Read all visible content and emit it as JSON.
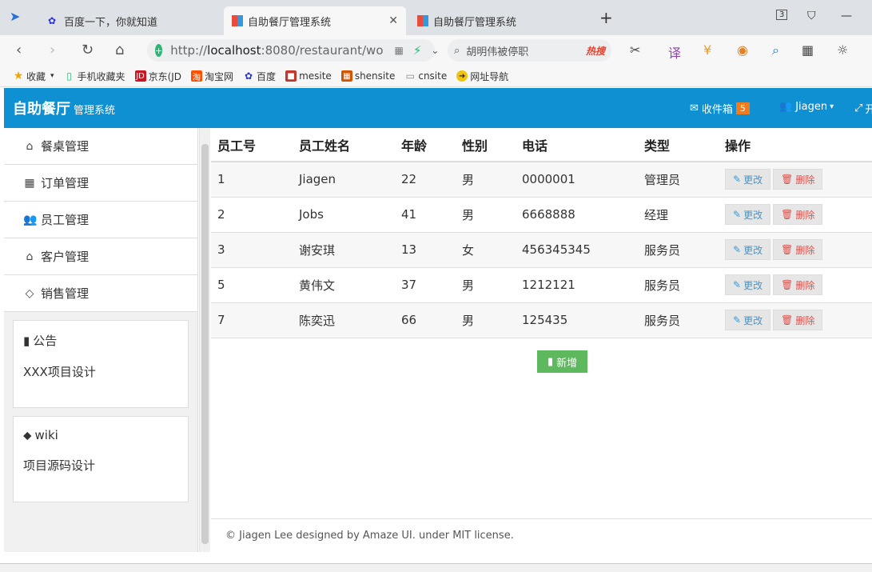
{
  "browser": {
    "tabs": [
      {
        "title": "百度一下，你就知道",
        "active": false
      },
      {
        "title": "自助餐厅管理系统",
        "active": true
      },
      {
        "title": "自助餐厅管理系统",
        "active": false
      }
    ],
    "new_tab": "+",
    "tab_count": "3",
    "url_prefix": "http://",
    "url_host": "localhost",
    "url_rest": ":8080/restaurant/wo",
    "search_text": "胡明伟被停职",
    "hot_label": "热搜"
  },
  "bookmarks": [
    {
      "label": "收藏",
      "icon": "star-icon"
    },
    {
      "label": "手机收藏夹",
      "icon": "phone-icon"
    },
    {
      "label": "京东(JD",
      "icon": "jd-icon"
    },
    {
      "label": "淘宝网",
      "icon": "taobao-icon"
    },
    {
      "label": "百度",
      "icon": "baidu-icon"
    },
    {
      "label": "mesite",
      "icon": "mesite-icon"
    },
    {
      "label": "shensite",
      "icon": "shensite-icon"
    },
    {
      "label": "cnsite",
      "icon": "page-icon"
    },
    {
      "label": "网址导航",
      "icon": "nav-icon"
    }
  ],
  "header": {
    "brand": "自助餐厅",
    "brand_sub": "管理系统",
    "inbox_label": "收件箱",
    "inbox_count": "5",
    "user_name": "Jiagen",
    "fullscreen_label": "开"
  },
  "sidebar": {
    "items": [
      {
        "label": "餐桌管理",
        "icon": "home-icon"
      },
      {
        "label": "订单管理",
        "icon": "table-icon"
      },
      {
        "label": "员工管理",
        "icon": "users-icon"
      },
      {
        "label": "客户管理",
        "icon": "bank-icon"
      },
      {
        "label": "销售管理",
        "icon": "diamond-icon"
      }
    ],
    "notice": {
      "title": "公告",
      "body": "XXX项目设计"
    },
    "wiki": {
      "title": "wiki",
      "body": "项目源码设计"
    }
  },
  "table": {
    "headers": [
      "员工号",
      "员工姓名",
      "年龄",
      "性别",
      "电话",
      "类型",
      "操作"
    ],
    "rows": [
      {
        "id": "1",
        "name": "Jiagen",
        "age": "22",
        "gender": "男",
        "phone": "0000001",
        "type": "管理员"
      },
      {
        "id": "2",
        "name": "Jobs",
        "age": "41",
        "gender": "男",
        "phone": "6668888",
        "type": "经理"
      },
      {
        "id": "3",
        "name": "谢安琪",
        "age": "13",
        "gender": "女",
        "phone": "456345345",
        "type": "服务员"
      },
      {
        "id": "5",
        "name": "黄伟文",
        "age": "37",
        "gender": "男",
        "phone": "1212121",
        "type": "服务员"
      },
      {
        "id": "7",
        "name": "陈奕迅",
        "age": "66",
        "gender": "男",
        "phone": "125435",
        "type": "服务员"
      }
    ],
    "edit_label": "更改",
    "delete_label": "删除",
    "add_label": "新增"
  },
  "footer": {
    "text": "© Jiagen Lee designed by Amaze UI. under MIT license."
  },
  "colors": {
    "header_bg": "#0e90d2",
    "add_btn": "#5eb95e",
    "badge": "#f37b1d",
    "delete_text": "#dd514c",
    "edit_text": "#3b99d3"
  }
}
